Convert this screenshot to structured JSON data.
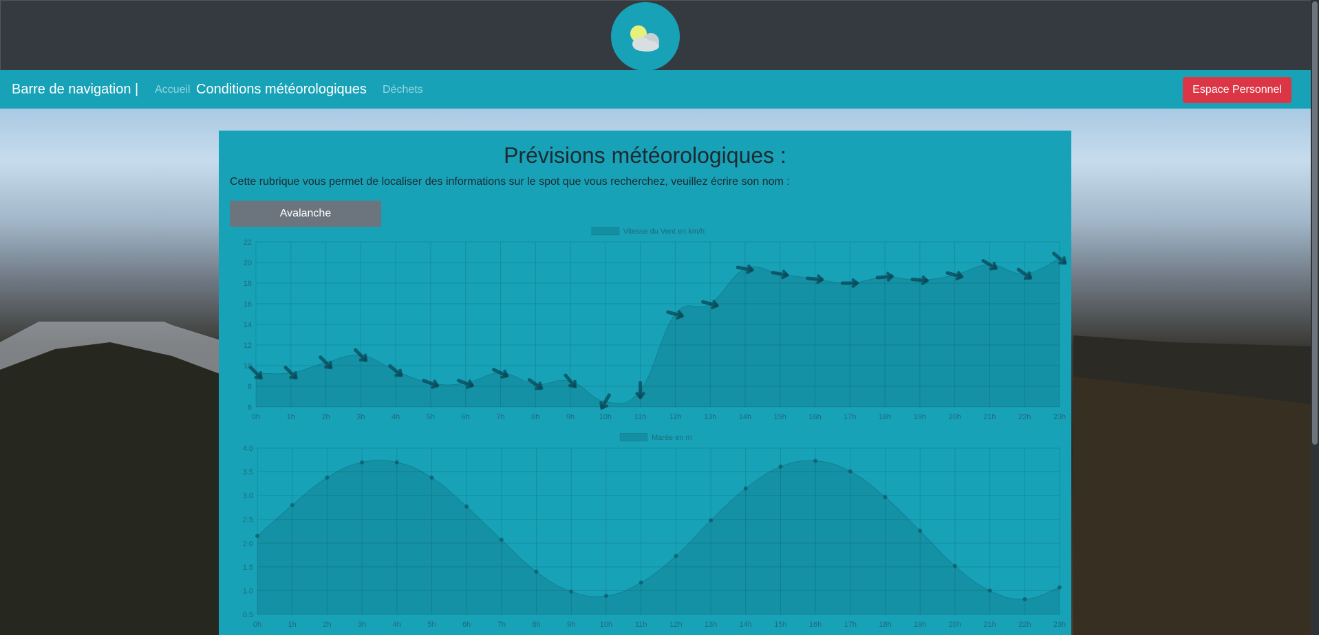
{
  "header": {
    "logo_icon": "weather-partly-cloudy-icon"
  },
  "navbar": {
    "brand": "Barre de navigation |",
    "links": [
      "Accueil",
      "Conditions météorologiques",
      "Déchets"
    ],
    "active_index": 1,
    "cta": "Espace Personnel"
  },
  "colors": {
    "primary": "#17a2b8",
    "dark": "#343a40",
    "danger": "#dc3545",
    "secondary": "#6c757d"
  },
  "main": {
    "title": "Prévisions météorologiques :",
    "description": "Cette rubrique vous permet de localiser des informations sur le spot que vous recherchez, veuillez écrire son nom :",
    "spot_button": "Avalanche"
  },
  "chart_data": [
    {
      "type": "area",
      "series_name": "Vitesse du Vent en km/h",
      "x": [
        "0h",
        "1h",
        "2h",
        "3h",
        "4h",
        "5h",
        "6h",
        "7h",
        "8h",
        "9h",
        "10h",
        "11h",
        "12h",
        "13h",
        "14h",
        "15h",
        "16h",
        "17h",
        "18h",
        "19h",
        "20h",
        "21h",
        "22h",
        "23h"
      ],
      "values": [
        9.3,
        9.3,
        10.3,
        11.0,
        9.5,
        8.3,
        8.3,
        9.3,
        8.2,
        8.5,
        6.5,
        7.6,
        15.0,
        16.0,
        19.4,
        18.9,
        18.4,
        18.0,
        18.6,
        18.3,
        18.8,
        19.8,
        18.9,
        20.4
      ],
      "wind_direction_deg": [
        45,
        45,
        45,
        45,
        40,
        20,
        20,
        25,
        35,
        50,
        120,
        90,
        15,
        15,
        10,
        10,
        5,
        0,
        -5,
        5,
        15,
        30,
        35,
        40
      ],
      "ylim": [
        6,
        22
      ],
      "yticks": [
        "6",
        "8",
        "10",
        "12",
        "14",
        "16",
        "18",
        "20",
        "22"
      ],
      "point_style": "arrow",
      "grid": true,
      "legend": "top"
    },
    {
      "type": "area",
      "series_name": "Marée en m",
      "x": [
        "0h",
        "1h",
        "2h",
        "3h",
        "4h",
        "5h",
        "6h",
        "7h",
        "8h",
        "9h",
        "10h",
        "11h",
        "12h",
        "13h",
        "14h",
        "15h",
        "16h",
        "17h",
        "18h",
        "19h",
        "20h",
        "21h",
        "22h",
        "23h"
      ],
      "values": [
        2.15,
        2.8,
        3.38,
        3.7,
        3.7,
        3.38,
        2.77,
        2.07,
        1.4,
        0.98,
        0.89,
        1.17,
        1.73,
        2.48,
        3.15,
        3.61,
        3.73,
        3.51,
        2.97,
        2.26,
        1.52,
        1.0,
        0.82,
        1.07
      ],
      "ylim": [
        0.5,
        4.0
      ],
      "yticks": [
        "0.5",
        "1.0",
        "1.5",
        "2.0",
        "2.5",
        "3.0",
        "3.5",
        "4.0"
      ],
      "point_style": "circle",
      "grid": true,
      "legend": "top"
    }
  ]
}
